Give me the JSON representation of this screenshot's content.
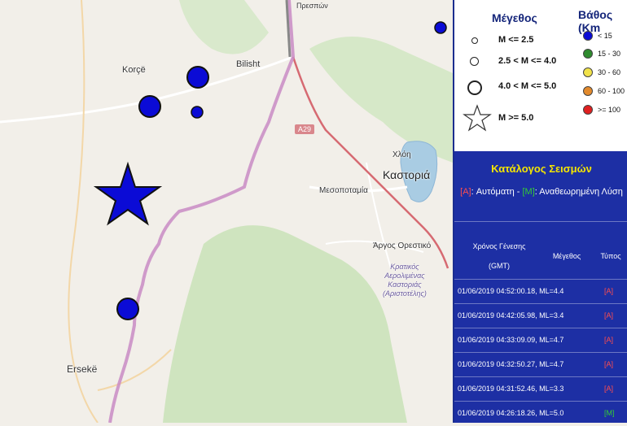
{
  "map": {
    "places": {
      "presp": "Πρεσπών",
      "korce": "Korçë",
      "bilisht": "Bilisht",
      "xloi": "Χλόη",
      "kastoria": "Καστοριά",
      "mesopotamia": "Μεσοποταμία",
      "argos": "Άργος Ορεστικό",
      "airport": "Κρατικός\nΑερολιμένας\nΚαστοριάς\n(Αριστοτέλης)",
      "erseke": "Ersekë"
    },
    "road_label": "A29",
    "colors": {
      "event_blue": "#0b0bd6",
      "border": "#c98bc4",
      "road": "#d66a72",
      "lake": "#a9cce3",
      "forest": "#cde3bd"
    }
  },
  "legend": {
    "magnitude_title": "Μέγεθος",
    "depth_title": "Βάθος (Km",
    "magnitudes": [
      "M <= 2.5",
      "2.5 < M <= 4.0",
      "4.0 < M <= 5.0",
      "M >= 5.0"
    ],
    "depths": [
      {
        "label": "< 15",
        "color": "#0b0bd6"
      },
      {
        "label": "15 - 30",
        "color": "#2e8b2e"
      },
      {
        "label": "30 - 60",
        "color": "#f1e24a"
      },
      {
        "label": "60 - 100",
        "color": "#e38a2c"
      },
      {
        "label": ">= 100",
        "color": "#e02020"
      }
    ]
  },
  "catalog": {
    "title": "Κατάλογος Σεισμών",
    "subtitle_a": "[A]",
    "subtitle_auto": ": Αυτόματη - ",
    "subtitle_m": "[M]",
    "subtitle_rev": ": Αναθεωρημένη Λύση",
    "headers": {
      "time": "Χρόνος Γένεσης",
      "gmt": "(GMT)",
      "magnitude": "Μέγεθος",
      "type": "Τύπος"
    },
    "rows": [
      {
        "text": "01/06/2019 04:52:00.18, ML=4.4",
        "type": "[A]"
      },
      {
        "text": "01/06/2019 04:42:05.98, ML=3.4",
        "type": "[A]"
      },
      {
        "text": "01/06/2019 04:33:09.09, ML=4.7",
        "type": "[A]"
      },
      {
        "text": "01/06/2019 04:32:50.27, ML=4.7",
        "type": "[A]"
      },
      {
        "text": "01/06/2019 04:31:52.46, ML=3.3",
        "type": "[A]"
      },
      {
        "text": "01/06/2019 04:26:18.26, ML=5.0",
        "type": "[M]"
      }
    ]
  }
}
